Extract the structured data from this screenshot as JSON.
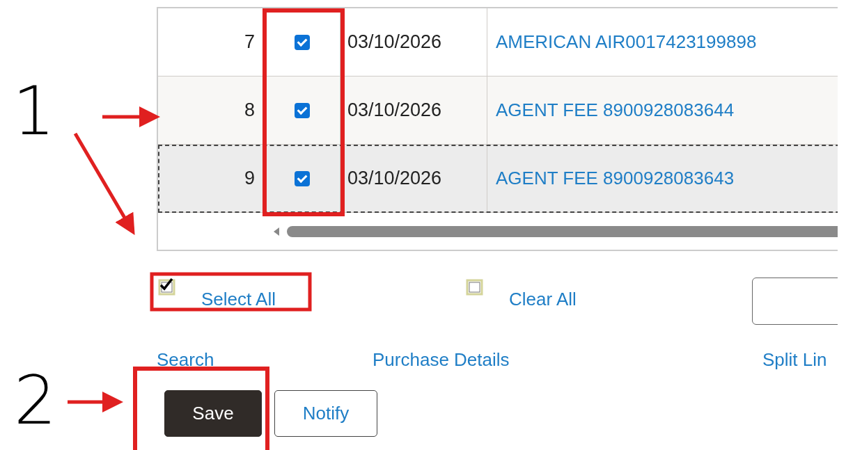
{
  "table": {
    "rows": [
      {
        "number": "7",
        "checked": true,
        "date": "03/10/2026",
        "description": "AMERICAN AIR0017423199898",
        "focused": false
      },
      {
        "number": "8",
        "checked": true,
        "date": "03/10/2026",
        "description": "AGENT FEE 8900928083644",
        "focused": false
      },
      {
        "number": "9",
        "checked": true,
        "date": "03/10/2026",
        "description": "AGENT FEE 8900928083643",
        "focused": true
      }
    ]
  },
  "selection_controls": [
    {
      "label": "Select All",
      "checked": true
    },
    {
      "label": "Clear All",
      "checked": false
    }
  ],
  "links": [
    "Search",
    "Purchase Details",
    "Split Lin"
  ],
  "buttons": [
    {
      "label": "Save",
      "kind": "primary"
    },
    {
      "label": "Notify",
      "kind": "secondary"
    }
  ],
  "annotations": {
    "markers": [
      {
        "label": "1"
      },
      {
        "label": "2"
      }
    ]
  }
}
